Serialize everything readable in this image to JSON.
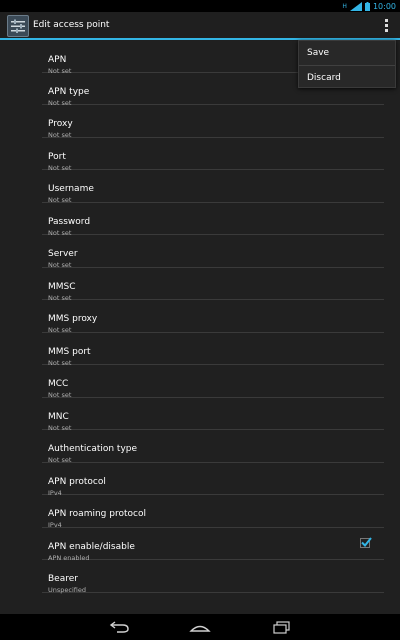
{
  "status_bar": {
    "time": "10:00",
    "network": "H",
    "icons": [
      "signal-icon",
      "battery-icon"
    ]
  },
  "action_bar": {
    "title": "Edit access point",
    "app_icon": "settings-icon",
    "overflow_icon": "overflow-menu-icon"
  },
  "overflow_menu": {
    "items": [
      {
        "label": "Save"
      },
      {
        "label": "Discard"
      }
    ]
  },
  "preferences": [
    {
      "title": "APN",
      "summary": "Not set"
    },
    {
      "title": "APN type",
      "summary": "Not set"
    },
    {
      "title": "Proxy",
      "summary": "Not set"
    },
    {
      "title": "Port",
      "summary": "Not set"
    },
    {
      "title": "Username",
      "summary": "Not set"
    },
    {
      "title": "Password",
      "summary": "Not set"
    },
    {
      "title": "Server",
      "summary": "Not set"
    },
    {
      "title": "MMSC",
      "summary": "Not set"
    },
    {
      "title": "MMS proxy",
      "summary": "Not set"
    },
    {
      "title": "MMS port",
      "summary": "Not set"
    },
    {
      "title": "MCC",
      "summary": "Not set"
    },
    {
      "title": "MNC",
      "summary": "Not set"
    },
    {
      "title": "Authentication type",
      "summary": "Not set"
    },
    {
      "title": "APN protocol",
      "summary": "IPv4"
    },
    {
      "title": "APN roaming protocol",
      "summary": "IPv4"
    },
    {
      "title": "APN enable/disable",
      "summary": "APN enabled",
      "checked": true
    },
    {
      "title": "Bearer",
      "summary": "Unspecified"
    }
  ],
  "nav_bar": {
    "icons": [
      "back-icon",
      "home-icon",
      "recent-apps-icon"
    ]
  },
  "colors": {
    "accent": "#33b5e5",
    "background": "#202020",
    "action_bar": "#1f1f1f"
  }
}
